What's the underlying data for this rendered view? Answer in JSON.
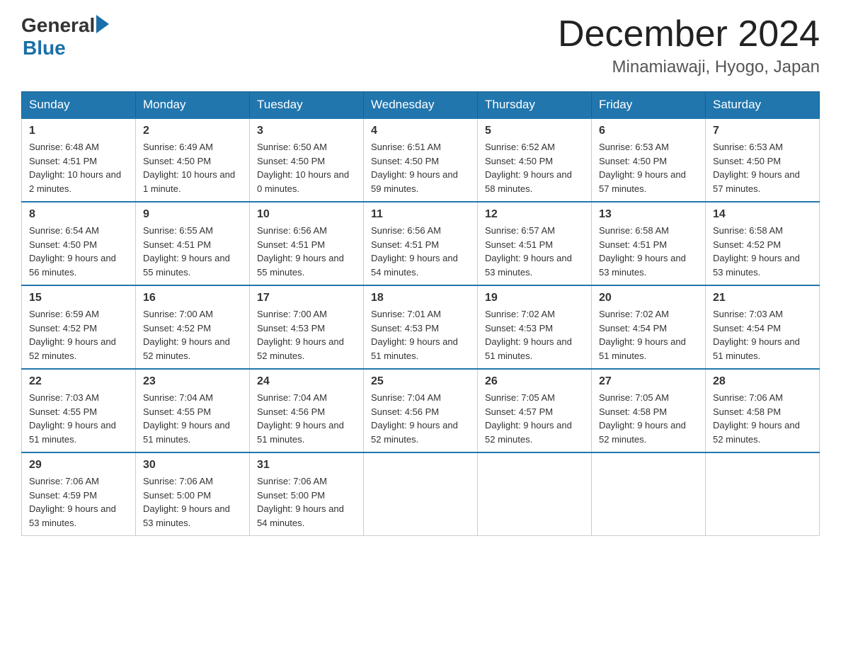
{
  "logo": {
    "general": "General",
    "blue": "Blue"
  },
  "title": "December 2024",
  "subtitle": "Minamiawaji, Hyogo, Japan",
  "headers": [
    "Sunday",
    "Monday",
    "Tuesday",
    "Wednesday",
    "Thursday",
    "Friday",
    "Saturday"
  ],
  "weeks": [
    [
      {
        "day": "1",
        "sunrise": "6:48 AM",
        "sunset": "4:51 PM",
        "daylight": "10 hours and 2 minutes."
      },
      {
        "day": "2",
        "sunrise": "6:49 AM",
        "sunset": "4:50 PM",
        "daylight": "10 hours and 1 minute."
      },
      {
        "day": "3",
        "sunrise": "6:50 AM",
        "sunset": "4:50 PM",
        "daylight": "10 hours and 0 minutes."
      },
      {
        "day": "4",
        "sunrise": "6:51 AM",
        "sunset": "4:50 PM",
        "daylight": "9 hours and 59 minutes."
      },
      {
        "day": "5",
        "sunrise": "6:52 AM",
        "sunset": "4:50 PM",
        "daylight": "9 hours and 58 minutes."
      },
      {
        "day": "6",
        "sunrise": "6:53 AM",
        "sunset": "4:50 PM",
        "daylight": "9 hours and 57 minutes."
      },
      {
        "day": "7",
        "sunrise": "6:53 AM",
        "sunset": "4:50 PM",
        "daylight": "9 hours and 57 minutes."
      }
    ],
    [
      {
        "day": "8",
        "sunrise": "6:54 AM",
        "sunset": "4:50 PM",
        "daylight": "9 hours and 56 minutes."
      },
      {
        "day": "9",
        "sunrise": "6:55 AM",
        "sunset": "4:51 PM",
        "daylight": "9 hours and 55 minutes."
      },
      {
        "day": "10",
        "sunrise": "6:56 AM",
        "sunset": "4:51 PM",
        "daylight": "9 hours and 55 minutes."
      },
      {
        "day": "11",
        "sunrise": "6:56 AM",
        "sunset": "4:51 PM",
        "daylight": "9 hours and 54 minutes."
      },
      {
        "day": "12",
        "sunrise": "6:57 AM",
        "sunset": "4:51 PM",
        "daylight": "9 hours and 53 minutes."
      },
      {
        "day": "13",
        "sunrise": "6:58 AM",
        "sunset": "4:51 PM",
        "daylight": "9 hours and 53 minutes."
      },
      {
        "day": "14",
        "sunrise": "6:58 AM",
        "sunset": "4:52 PM",
        "daylight": "9 hours and 53 minutes."
      }
    ],
    [
      {
        "day": "15",
        "sunrise": "6:59 AM",
        "sunset": "4:52 PM",
        "daylight": "9 hours and 52 minutes."
      },
      {
        "day": "16",
        "sunrise": "7:00 AM",
        "sunset": "4:52 PM",
        "daylight": "9 hours and 52 minutes."
      },
      {
        "day": "17",
        "sunrise": "7:00 AM",
        "sunset": "4:53 PM",
        "daylight": "9 hours and 52 minutes."
      },
      {
        "day": "18",
        "sunrise": "7:01 AM",
        "sunset": "4:53 PM",
        "daylight": "9 hours and 51 minutes."
      },
      {
        "day": "19",
        "sunrise": "7:02 AM",
        "sunset": "4:53 PM",
        "daylight": "9 hours and 51 minutes."
      },
      {
        "day": "20",
        "sunrise": "7:02 AM",
        "sunset": "4:54 PM",
        "daylight": "9 hours and 51 minutes."
      },
      {
        "day": "21",
        "sunrise": "7:03 AM",
        "sunset": "4:54 PM",
        "daylight": "9 hours and 51 minutes."
      }
    ],
    [
      {
        "day": "22",
        "sunrise": "7:03 AM",
        "sunset": "4:55 PM",
        "daylight": "9 hours and 51 minutes."
      },
      {
        "day": "23",
        "sunrise": "7:04 AM",
        "sunset": "4:55 PM",
        "daylight": "9 hours and 51 minutes."
      },
      {
        "day": "24",
        "sunrise": "7:04 AM",
        "sunset": "4:56 PM",
        "daylight": "9 hours and 51 minutes."
      },
      {
        "day": "25",
        "sunrise": "7:04 AM",
        "sunset": "4:56 PM",
        "daylight": "9 hours and 52 minutes."
      },
      {
        "day": "26",
        "sunrise": "7:05 AM",
        "sunset": "4:57 PM",
        "daylight": "9 hours and 52 minutes."
      },
      {
        "day": "27",
        "sunrise": "7:05 AM",
        "sunset": "4:58 PM",
        "daylight": "9 hours and 52 minutes."
      },
      {
        "day": "28",
        "sunrise": "7:06 AM",
        "sunset": "4:58 PM",
        "daylight": "9 hours and 52 minutes."
      }
    ],
    [
      {
        "day": "29",
        "sunrise": "7:06 AM",
        "sunset": "4:59 PM",
        "daylight": "9 hours and 53 minutes."
      },
      {
        "day": "30",
        "sunrise": "7:06 AM",
        "sunset": "5:00 PM",
        "daylight": "9 hours and 53 minutes."
      },
      {
        "day": "31",
        "sunrise": "7:06 AM",
        "sunset": "5:00 PM",
        "daylight": "9 hours and 54 minutes."
      },
      null,
      null,
      null,
      null
    ]
  ]
}
